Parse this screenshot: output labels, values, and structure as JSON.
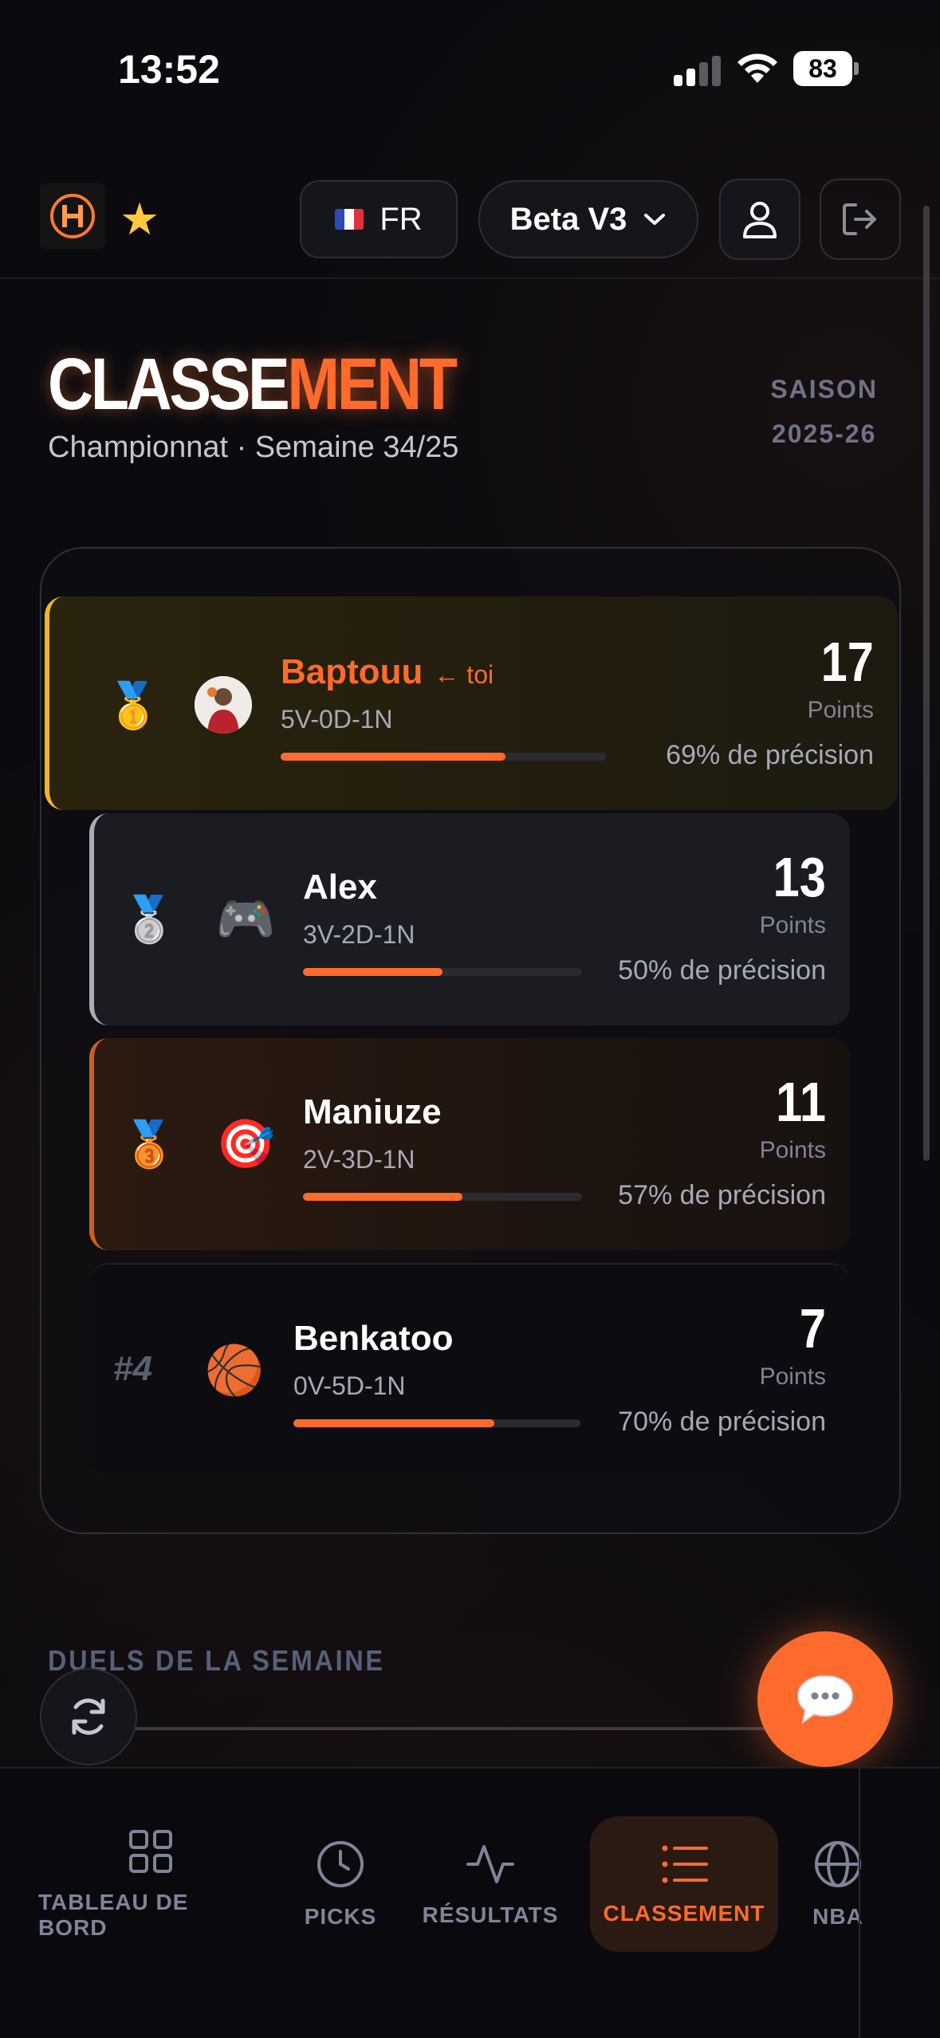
{
  "status_bar": {
    "time": "13:52",
    "battery": "83"
  },
  "header": {
    "language_label": "FR",
    "version_label": "Beta V3",
    "title_white": "CLASSE",
    "title_orange": "MENT",
    "subtitle": "Championnat · Semaine 34/25",
    "season_label": "SAISON",
    "season_value": "2025-26"
  },
  "colors": {
    "accent": "#ff6b2c",
    "gold": "#f0b429",
    "silver": "#a9acb8",
    "bronze": "#c8621f",
    "background": "#0b0b0f"
  },
  "ranking": [
    {
      "rank": "1",
      "icon": "gold-medal-icon",
      "avatar": "player-photo",
      "name": "Baptouu",
      "you_marker": "← toi",
      "record": "5V-0D-1N",
      "progress": 0.69,
      "points": "17",
      "points_label": "Points",
      "precision": "69% de précision"
    },
    {
      "rank": "2",
      "icon": "silver-medal-icon",
      "avatar": "gamepad-icon",
      "name": "Alex",
      "you_marker": "",
      "record": "3V-2D-1N",
      "progress": 0.5,
      "points": "13",
      "points_label": "Points",
      "precision": "50% de précision"
    },
    {
      "rank": "3",
      "icon": "bronze-medal-icon",
      "avatar": "target-icon",
      "name": "Maniuze",
      "you_marker": "",
      "record": "2V-3D-1N",
      "progress": 0.57,
      "points": "11",
      "points_label": "Points",
      "precision": "57% de précision"
    },
    {
      "rank": "#4",
      "icon": "",
      "avatar": "basketball-icon",
      "name": "Benkatoo",
      "you_marker": "",
      "record": "0V-5D-1N",
      "progress": 0.7,
      "points": "7",
      "points_label": "Points",
      "precision": "70% de précision"
    }
  ],
  "duels": {
    "title": "DUELS DE LA SEMAINE"
  },
  "nav": [
    {
      "label": "TABLEAU DE BORD",
      "icon": "grid-icon",
      "active": false
    },
    {
      "label": "PICKS",
      "icon": "clock-icon",
      "active": false
    },
    {
      "label": "RÉSULTATS",
      "icon": "activity-icon",
      "active": false
    },
    {
      "label": "CLASSEMENT",
      "icon": "list-icon",
      "active": true
    },
    {
      "label": "NBA",
      "icon": "globe-icon",
      "active": false
    }
  ]
}
